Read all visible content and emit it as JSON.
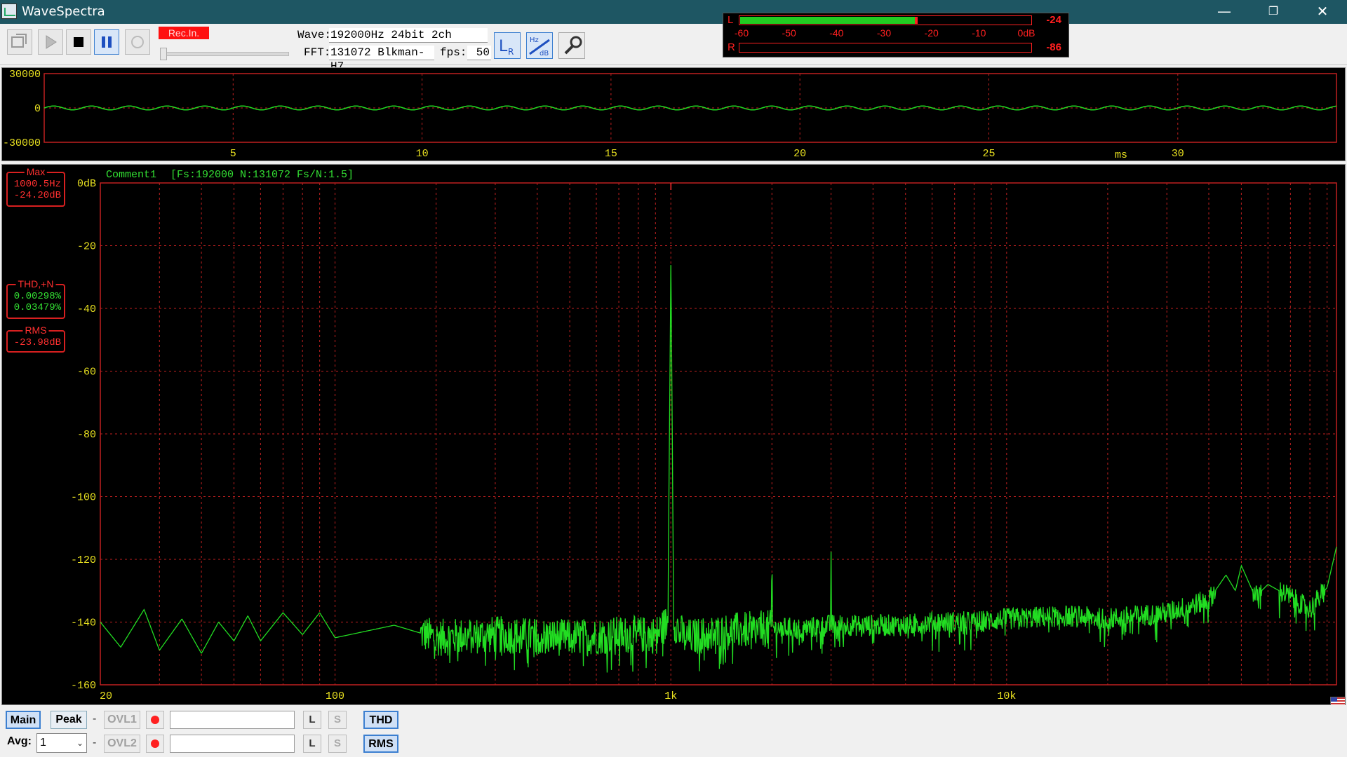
{
  "window": {
    "title": "WaveSpectra",
    "minimize_glyph": "—",
    "restore_glyph": "❐",
    "close_glyph": "✕"
  },
  "toolbar": {
    "rec_label": "Rec.In.",
    "wave_label": "Wave:",
    "wave_value": "192000Hz 24bit 2ch",
    "fft_label": "FFT:",
    "fft_value": "131072 Blkman-H7",
    "fps_label": "fps:",
    "fps_value": "50",
    "buttons": [
      "open-icon",
      "play-icon",
      "stop-icon",
      "pause-icon",
      "record-icon",
      "lr-channel-icon",
      "hz-db-scale-icon",
      "settings-wrench-icon"
    ]
  },
  "level_meter": {
    "left_label": "L",
    "right_label": "R",
    "left_value": "-24",
    "right_value": "-86",
    "left_level_db": -24,
    "right_level_db": -86,
    "scale": [
      "-60",
      "-50",
      "-40",
      "-30",
      "-20",
      "-10",
      "0dB"
    ],
    "colors": {
      "bar": "#22cc22",
      "frame": "#ff2020"
    }
  },
  "waveform": {
    "y_ticks": [
      "30000",
      "0",
      "-30000"
    ],
    "x_ticks": [
      "5",
      "10",
      "15",
      "20",
      "25",
      "30"
    ],
    "x_unit": "ms",
    "amplitude": 1700,
    "cycles_per_ms": 1.0,
    "x_range_ms": [
      0,
      34.2
    ],
    "y_range": [
      -30000,
      30000
    ],
    "colors": {
      "trace": "#22dd22",
      "grid": "#c02020"
    }
  },
  "spectrum": {
    "comment": "Comment1",
    "params": "[Fs:192000 N:131072 Fs/N:1.5]",
    "max": {
      "title": "Max",
      "freq": "1000.5Hz",
      "level": "-24.20dB"
    },
    "thd": {
      "title": "THD,+N",
      "thd": "0.00298%",
      "thdn": "0.03479%"
    },
    "rms": {
      "title": "RMS",
      "value": "-23.98dB"
    }
  },
  "chart_data": {
    "type": "line",
    "title": "",
    "xlabel": "",
    "ylabel": "",
    "x_scale": "log",
    "xlim": [
      20,
      96000
    ],
    "ylim": [
      -160,
      0
    ],
    "y_ticks": [
      "0dB",
      "-20",
      "-40",
      "-60",
      "-80",
      "-100",
      "-120",
      "-140",
      "-160"
    ],
    "x_ticks": [
      "20",
      "100",
      "1k",
      "10k"
    ],
    "grid": true,
    "series": [
      {
        "x": [
          20,
          23,
          27,
          30,
          35,
          40,
          45,
          50,
          55,
          60,
          70,
          80,
          90,
          100,
          150,
          200,
          300,
          500,
          700,
          900,
          980,
          1000.5,
          1020,
          1100,
          1500,
          1990,
          2000,
          2010,
          2500,
          2990,
          3000,
          3010,
          3500,
          4000,
          5000,
          6000,
          8000,
          10000,
          15000,
          20000,
          30000,
          40000,
          45000,
          48000,
          50000,
          55000,
          60000,
          70000,
          80000,
          90000,
          96000
        ],
        "y": [
          -140,
          -148,
          -136,
          -149,
          -139,
          -150,
          -140,
          -146,
          -138,
          -146,
          -137,
          -144,
          -137,
          -145,
          -141,
          -145,
          -144,
          -145,
          -144,
          -144,
          -140,
          -24.2,
          -140,
          -145,
          -143,
          -142,
          -118,
          -142,
          -142,
          -141,
          -116,
          -141,
          -141,
          -141,
          -141,
          -140,
          -140,
          -139,
          -138,
          -139,
          -137,
          -133,
          -125,
          -130,
          -122,
          -132,
          -128,
          -132,
          -136,
          -129,
          -116
        ]
      }
    ]
  },
  "bottom": {
    "main_label": "Main",
    "peak_label": "Peak",
    "dash": "-",
    "ovl1_label": "OVL1",
    "ovl2_label": "OVL2",
    "l_label": "L",
    "s_label": "S",
    "thd_label": "THD",
    "rms_label": "RMS",
    "avg_label": "Avg:",
    "avg_value": "1"
  }
}
